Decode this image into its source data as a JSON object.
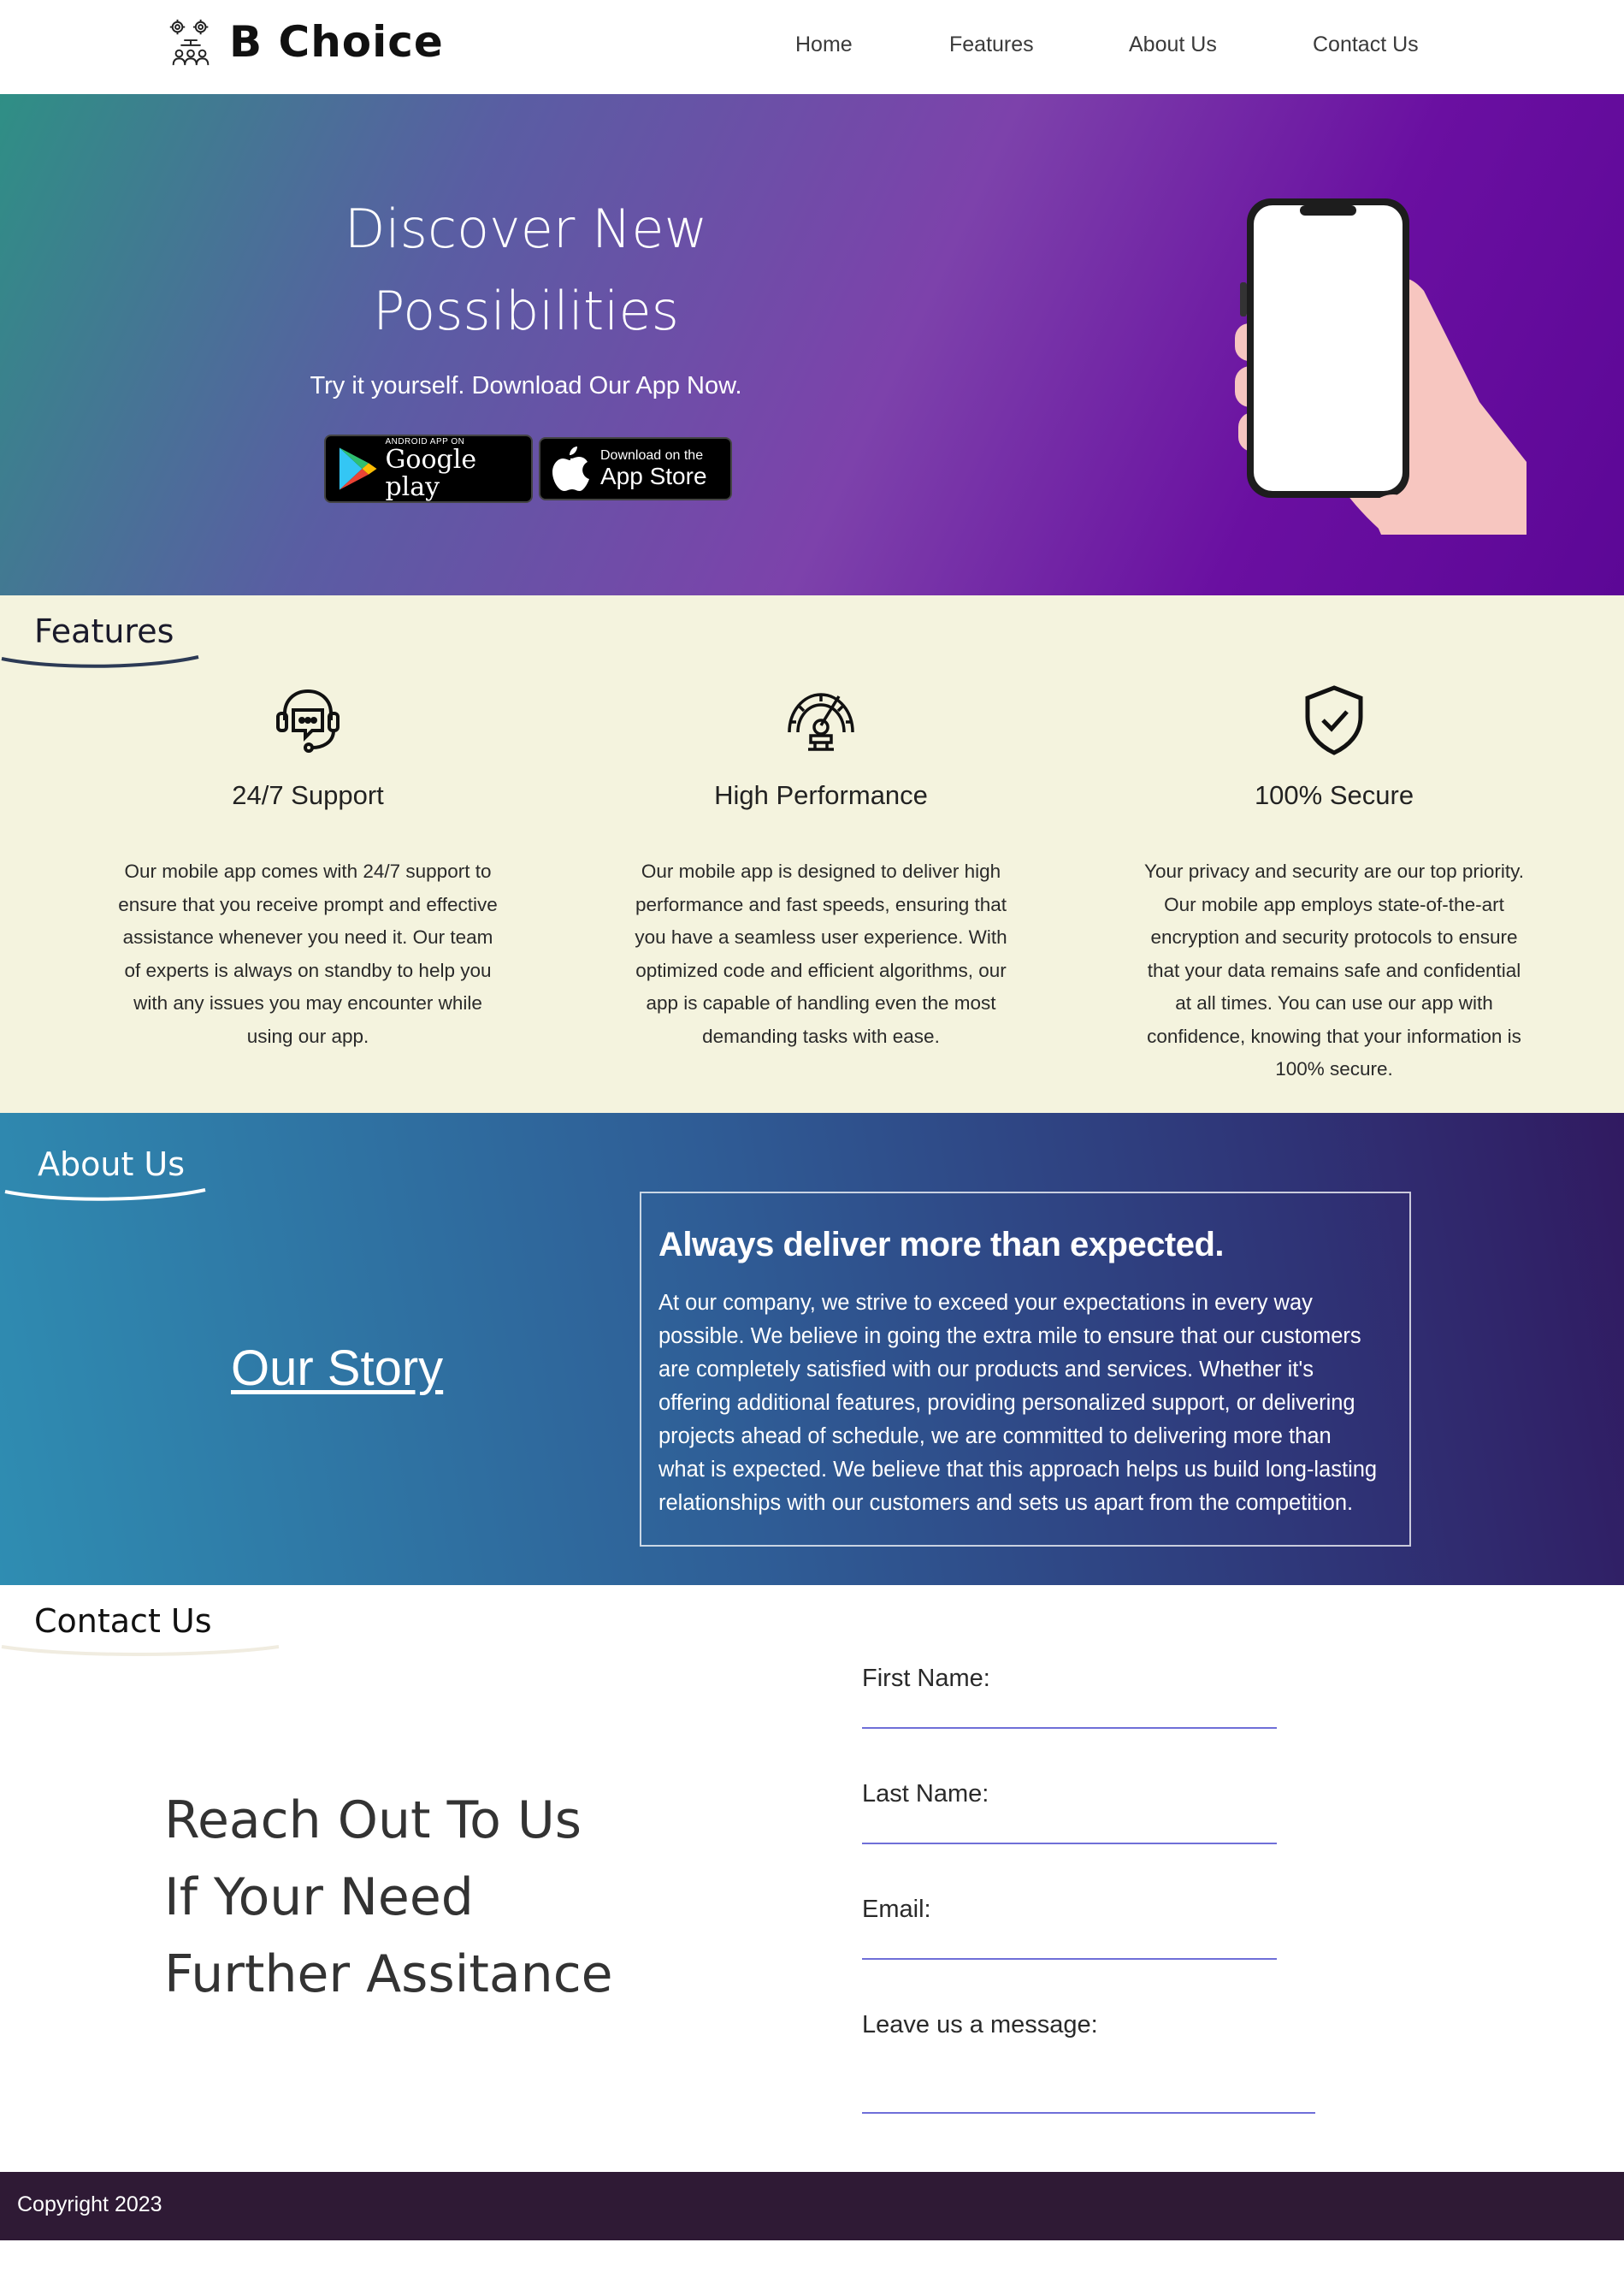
{
  "navbar": {
    "brand": "B Choice",
    "logo_icon": "team-gears-icon",
    "links": [
      "Home",
      "Features",
      "About Us",
      "Contact Us"
    ]
  },
  "hero": {
    "title_line1": "Discover New",
    "title_line2": "Possibilities",
    "subtitle": "Try it yourself. Download Our App Now.",
    "google_play": {
      "small": "ANDROID APP ON",
      "big": "Google play",
      "icon": "google-play-icon"
    },
    "app_store": {
      "small": "Download on the",
      "big": "App Store",
      "icon": "apple-icon"
    },
    "illustration": "hand-holding-phone",
    "colors": {
      "gradient_start": "#2f8f85",
      "gradient_mid": "#7d42ab",
      "gradient_end": "#5c0796"
    }
  },
  "features": {
    "heading": "Features",
    "items": [
      {
        "icon": "support-chat-icon",
        "title": "24/7 Support",
        "desc_lines": [
          "Our mobile app comes with 24/7 support to",
          "ensure that you receive prompt and effective",
          "assistance whenever you need it. Our team",
          "of experts is always on standby to help you",
          "with any issues you may encounter while",
          "using our app."
        ]
      },
      {
        "icon": "speedometer-icon",
        "title": "High Performance",
        "desc_lines": [
          "Our mobile app is designed to deliver high",
          "performance and fast speeds, ensuring that",
          "you have a seamless user experience. With",
          "optimized code and efficient algorithms, our",
          "app is capable of handling even the most",
          "demanding tasks with ease."
        ]
      },
      {
        "icon": "shield-check-icon",
        "title": "100% Secure",
        "desc_lines": [
          "Your privacy and security are our top priority.",
          "Our mobile app employs state-of-the-art",
          "encryption and security protocols to ensure",
          "that your data remains safe and confidential",
          "at all times. You can use our app with",
          "confidence, knowing that your information is",
          "100% secure."
        ]
      }
    ],
    "colors": {
      "background": "#f4f3de"
    }
  },
  "about": {
    "heading": "About Us",
    "story_link": "Our Story",
    "box_title": "Always deliver more than expected.",
    "box_lines": [
      "At our company, we strive to exceed your expectations in every way",
      "possible. We believe in going the extra mile to ensure that our customers",
      "are completely satisfied with our products and services. Whether it's",
      "offering additional features, providing personalized support, or delivering",
      "projects ahead of schedule, we are committed to delivering more than",
      "what is expected. We believe that this approach helps us build long-lasting",
      "relationships with our customers and sets us apart from the competition."
    ]
  },
  "contact": {
    "heading": "Contact Us",
    "reach_lines": [
      "Reach Out To Us",
      "If Your Need",
      "Further Assitance"
    ],
    "fields": {
      "first_name": {
        "label": "First Name:",
        "value": ""
      },
      "last_name": {
        "label": "Last Name:",
        "value": ""
      },
      "email": {
        "label": "Email:",
        "value": ""
      },
      "message": {
        "label": "Leave us a message:",
        "value": ""
      }
    },
    "colors": {
      "input_underline": "#6f6fd8"
    }
  },
  "footer": {
    "copyright": "Copyright 2023",
    "colors": {
      "background": "#2f1a35"
    }
  }
}
